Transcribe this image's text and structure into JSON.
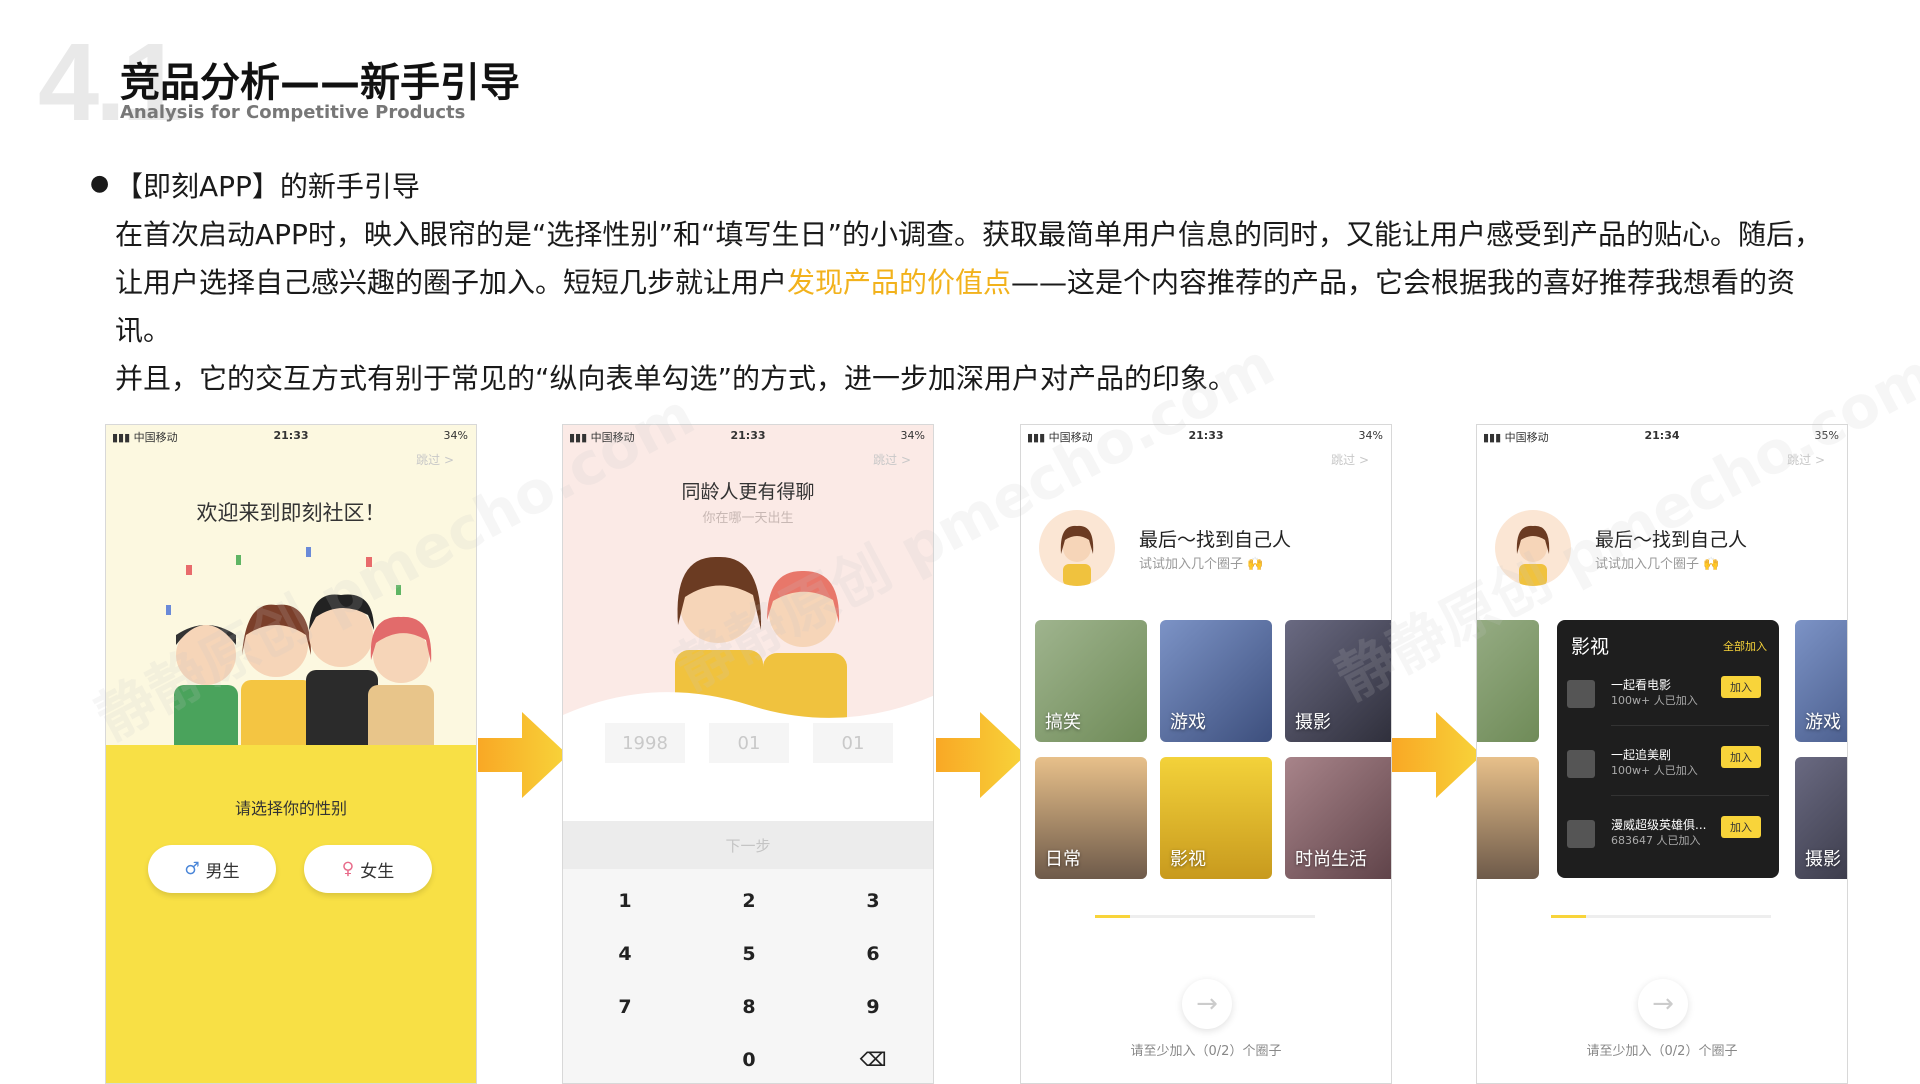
{
  "header": {
    "section_number": "4.1",
    "title": "竞品分析——新手引导",
    "subtitle": "Analysis for Competitive Products"
  },
  "body": {
    "bullet_title": "【即刻APP】的新手引导",
    "para1_line1": "在首次启动APP时，映入眼帘的是“选择性别”和“填写生日”的小调查。获取最简单用户信息的同时，又能让用户感受到产品的贴心。随后，",
    "para1_line2_a": "让用户选择自己感兴趣的圈子加入。短短几步就让用户",
    "para1_line2_highlight": "发现产品的价值点",
    "para1_line2_b": "——这是个内容推荐的产品，它会根据我的喜好推荐我想看的资",
    "para1_line3": "讯。",
    "para2": "并且，它的交互方式有别于常见的“纵向表单勾选”的方式，进一步加深用户对产品的印象。",
    "highlight_color": "#f2b21c"
  },
  "status_bars": [
    {
      "carrier": "中国移动",
      "time": "21:33",
      "battery": "34%"
    },
    {
      "carrier": "中国移动",
      "time": "21:33",
      "battery": "34%"
    },
    {
      "carrier": "中国移动",
      "time": "21:33",
      "battery": "34%"
    },
    {
      "carrier": "中国移动",
      "time": "21:34",
      "battery": "35%"
    }
  ],
  "skip_label": "跳过 >",
  "phone1": {
    "welcome": "欢迎来到即刻社区！",
    "choose_gender": "请选择你的性别",
    "male": "男生",
    "female": "女生"
  },
  "phone2": {
    "heading": "同龄人更有得聊",
    "subheading": "你在哪一天出生",
    "year_placeholder": "1998",
    "month_placeholder": "01",
    "day_placeholder": "01",
    "next": "下一步",
    "keys": [
      "1",
      "2",
      "3",
      "4",
      "5",
      "6",
      "7",
      "8",
      "9",
      "0"
    ]
  },
  "phone3": {
    "lead": "最后～找到自己人",
    "lead_sub": "试试加入几个圈子 🙌",
    "tiles": [
      "搞笑",
      "游戏",
      "摄影",
      "日常",
      "影视",
      "时尚生活"
    ],
    "hint": "请至少加入（0/2）个圈子",
    "progress": 0.16
  },
  "phone4": {
    "lead": "最后～找到自己人",
    "lead_sub": "试试加入几个圈子 🙌",
    "popup_title": "影视",
    "popup_all": "全部加入",
    "rows": [
      {
        "name": "一起看电影",
        "count": "100w+ 人已加入",
        "add": "加入"
      },
      {
        "name": "一起追美剧",
        "count": "100w+ 人已加入",
        "add": "加入"
      },
      {
        "name": "漫威超级英雄俱...",
        "count": "683647 人已加入",
        "add": "加入"
      }
    ],
    "side_right_top": "游戏",
    "side_right_bottom": "摄影",
    "hint": "请至少加入（0/2）个圈子",
    "progress": 0.16
  },
  "watermark": "静静原创 pmecho.com"
}
